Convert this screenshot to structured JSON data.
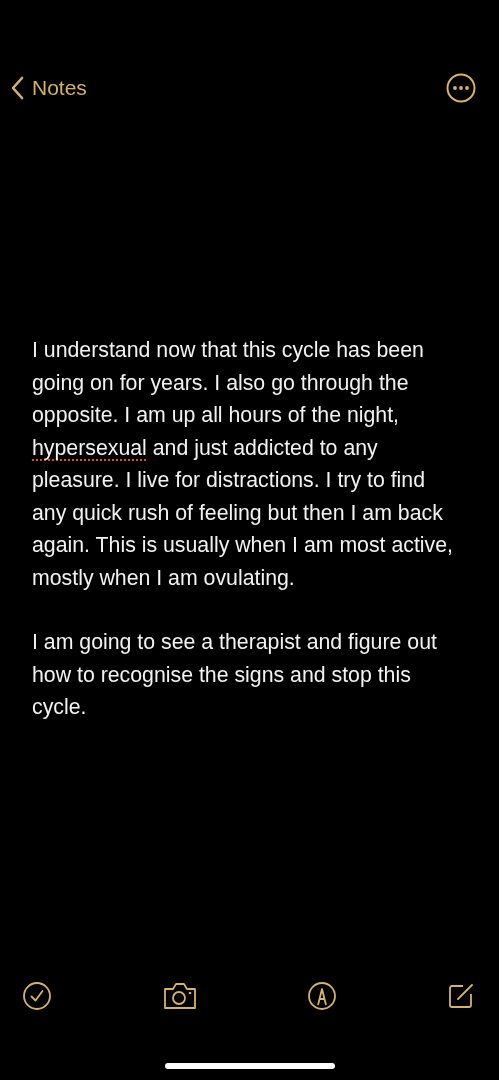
{
  "nav_bar": {
    "back_label": "Notes"
  },
  "note": {
    "paragraphs": [
      [
        {
          "text": "I understand now that this cycle has been going on for years. I also go through the opposite. I am up all hours of the night, ",
          "misspelled": false
        },
        {
          "text": "hypersexual",
          "misspelled": true
        },
        {
          "text": " and just addicted to any pleasure. I live for distractions. I try to find any quick rush of feeling but then I am back again. This is usually when I am most active, mostly when I am ovulating.",
          "misspelled": false
        }
      ],
      [
        {
          "text": "I am going to see a therapist and figure out how to recognise the signs and stop this cycle.",
          "misspelled": false
        }
      ]
    ]
  },
  "toolbar": [
    {
      "kind": "checklist"
    },
    {
      "kind": "camera"
    },
    {
      "kind": "markup"
    },
    {
      "kind": "compose"
    }
  ]
}
